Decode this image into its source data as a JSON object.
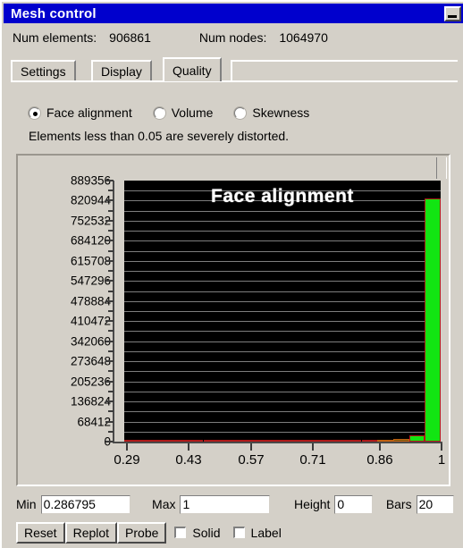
{
  "window": {
    "title": "Mesh control",
    "minimize_icon": "minimize-icon"
  },
  "header": {
    "num_elements_label": "Num elements:",
    "num_elements_value": "906861",
    "num_nodes_label": "Num nodes:",
    "num_nodes_value": "1064970"
  },
  "tabs": [
    {
      "label": "Settings",
      "active": false
    },
    {
      "label": "Display",
      "active": false
    },
    {
      "label": "Quality",
      "active": true
    }
  ],
  "metric_options": [
    {
      "label": "Face alignment",
      "selected": true
    },
    {
      "label": "Volume",
      "selected": false
    },
    {
      "label": "Skewness",
      "selected": false
    }
  ],
  "note": "Elements less than 0.05 are severely distorted.",
  "controls": {
    "min_label": "Min",
    "min_value": "0.286795",
    "max_label": "Max",
    "max_value": "1",
    "height_label": "Height",
    "height_value": "0",
    "bars_label": "Bars",
    "bars_value": "20",
    "reset_label": "Reset",
    "replot_label": "Replot",
    "probe_label": "Probe",
    "solid_label": "Solid",
    "solid_checked": false,
    "label_label": "Label",
    "label_checked": false
  },
  "colors": {
    "titlebar": "#0000cd",
    "face": "#d4d0c8",
    "bar_fill": "#12e512",
    "bar_outline": "#b01818",
    "plot_bg": "#000000",
    "gridline": "#7d7d7d"
  },
  "chart_data": {
    "type": "bar",
    "title": "Face alignment",
    "xlabel": "",
    "ylabel": "",
    "grid": true,
    "legend": "none",
    "xlim": [
      0.286795,
      1.0
    ],
    "ylim": [
      0,
      889356
    ],
    "ytick_labels": [
      "889356",
      "820944",
      "752532",
      "684120",
      "615708",
      "547296",
      "478884",
      "410472",
      "342060",
      "273648",
      "205236",
      "136824",
      "68412",
      "0"
    ],
    "ytick_values": [
      889356,
      820944,
      752532,
      684120,
      615708,
      547296,
      478884,
      410472,
      342060,
      273648,
      205236,
      136824,
      68412,
      0
    ],
    "xtick_labels": [
      "0.29",
      "0.43",
      "0.57",
      "0.71",
      "0.86",
      "1"
    ],
    "xtick_values": [
      0.29,
      0.43,
      0.57,
      0.71,
      0.86,
      1.0
    ],
    "bars": 20,
    "bin_centers": [
      0.305,
      0.34,
      0.376,
      0.411,
      0.447,
      0.482,
      0.518,
      0.554,
      0.589,
      0.625,
      0.66,
      0.696,
      0.731,
      0.767,
      0.803,
      0.838,
      0.874,
      0.909,
      0.945,
      0.98
    ],
    "values": [
      0,
      0,
      0,
      0,
      0,
      0,
      0,
      0,
      0,
      0,
      0,
      0,
      0,
      0,
      0,
      0,
      4000,
      9000,
      22000,
      830000
    ]
  }
}
